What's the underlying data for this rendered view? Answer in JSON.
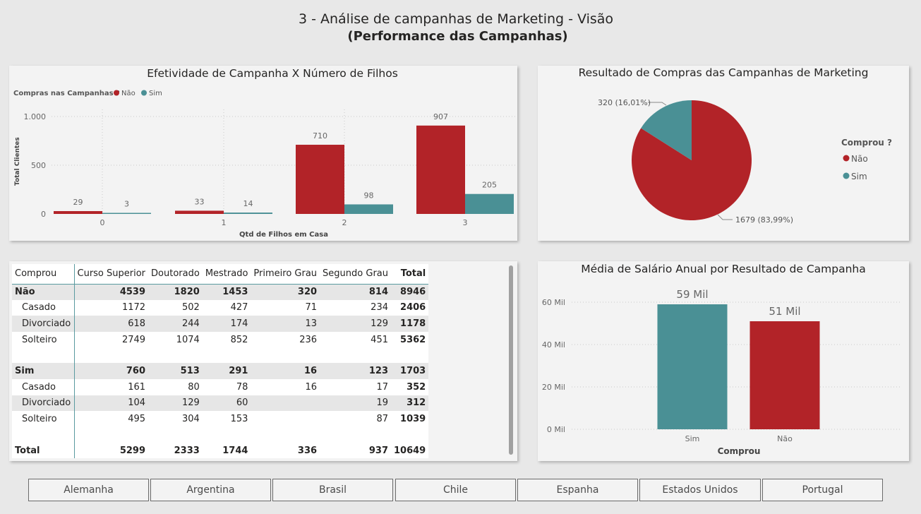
{
  "header": {
    "title": "3 - Análise de campanhas de Marketing - Visão",
    "subtitle": "(Performance das Campanhas)"
  },
  "colors": {
    "nao": "#b22328",
    "sim": "#4a9095"
  },
  "bar_chart": {
    "title": "Efetividade de Campanha X Número de Filhos",
    "legend_title": "Compras nas Campanhas ?",
    "legend_nao": "Não",
    "legend_sim": "Sim",
    "ylabel": "Total Clientes",
    "xlabel": "Qtd de Filhos em Casa",
    "yticks": [
      "1.000",
      "500",
      "0"
    ],
    "xticks": [
      "0",
      "1",
      "2",
      "3"
    ],
    "labels_nao": [
      "29",
      "33",
      "710",
      "907"
    ],
    "labels_sim": [
      "3",
      "14",
      "98",
      "205"
    ]
  },
  "pie_chart": {
    "title": "Resultado de Compras das Campanhas de Marketing",
    "legend_title": "Comprou ?",
    "legend_nao": "Não",
    "legend_sim": "Sim",
    "label_sim": "320 (16,01%)",
    "label_nao": "1679 (83,99%)"
  },
  "salary_chart": {
    "title": "Média de Salário Anual por Resultado de Campanha",
    "yticks": [
      "60 Mil",
      "40 Mil",
      "20 Mil",
      "0 Mil"
    ],
    "xticks": [
      "Sim",
      "Não"
    ],
    "xlabel": "Comprou",
    "labels": [
      "59 Mil",
      "51 Mil"
    ]
  },
  "table": {
    "headers": [
      "Comprou",
      "Curso Superior",
      "Doutorado",
      "Mestrado",
      "Primeiro Grau",
      "Segundo Grau",
      "Total"
    ],
    "rows": [
      [
        "Não",
        "4539",
        "1820",
        "1453",
        "320",
        "814",
        "8946"
      ],
      [
        "Casado",
        "1172",
        "502",
        "427",
        "71",
        "234",
        "2406"
      ],
      [
        "Divorciado",
        "618",
        "244",
        "174",
        "13",
        "129",
        "1178"
      ],
      [
        "Solteiro",
        "2749",
        "1074",
        "852",
        "236",
        "451",
        "5362"
      ],
      [
        "Sim",
        "760",
        "513",
        "291",
        "16",
        "123",
        "1703"
      ],
      [
        "Casado",
        "161",
        "80",
        "78",
        "16",
        "17",
        "352"
      ],
      [
        "Divorciado",
        "104",
        "129",
        "60",
        "",
        "19",
        "312"
      ],
      [
        "Solteiro",
        "495",
        "304",
        "153",
        "",
        "87",
        "1039"
      ],
      [
        "Total",
        "5299",
        "2333",
        "1744",
        "336",
        "937",
        "10649"
      ]
    ]
  },
  "slicer": [
    "Alemanha",
    "Argentina",
    "Brasil",
    "Chile",
    "Espanha",
    "Estados Unidos",
    "Portugal"
  ],
  "chart_data": [
    {
      "type": "bar",
      "title": "Efetividade de Campanha X Número de Filhos",
      "xlabel": "Qtd de Filhos em Casa",
      "ylabel": "Total Clientes",
      "categories": [
        "0",
        "1",
        "2",
        "3"
      ],
      "series": [
        {
          "name": "Não",
          "values": [
            29,
            33,
            710,
            907
          ]
        },
        {
          "name": "Sim",
          "values": [
            3,
            14,
            98,
            205
          ]
        }
      ],
      "ylim": [
        0,
        1000
      ],
      "legend": "top-left"
    },
    {
      "type": "pie",
      "title": "Resultado de Compras das Campanhas de Marketing",
      "categories": [
        "Não",
        "Sim"
      ],
      "values": [
        1679,
        320
      ],
      "legend": "right"
    },
    {
      "type": "bar",
      "title": "Média de Salário Anual por Resultado de Campanha",
      "xlabel": "Comprou",
      "categories": [
        "Sim",
        "Não"
      ],
      "values": [
        59,
        51
      ],
      "ylim": [
        0,
        60
      ]
    }
  ]
}
